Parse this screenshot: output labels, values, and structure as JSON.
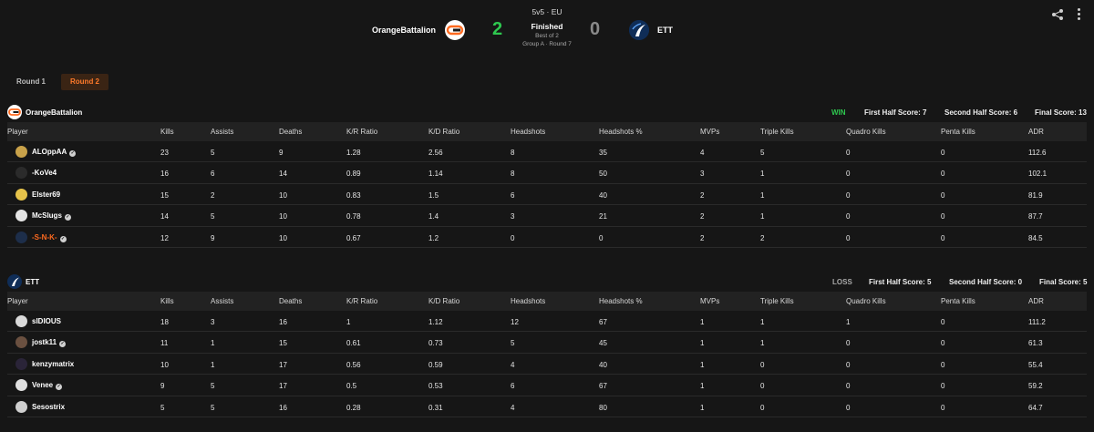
{
  "header": {
    "team1": {
      "name": "OrangeBattalion",
      "score": "2"
    },
    "team2": {
      "name": "ETT",
      "score": "0"
    },
    "mode": "5v5 · EU",
    "status": "Finished",
    "best_of": "Best of 2",
    "group": "Group A · Round 7",
    "colors": {
      "win": "#2ec84f",
      "lose": "#8a8a8a",
      "accent": "#ff7a2a"
    }
  },
  "icons": {
    "share": "share-icon",
    "more": "more-vertical-icon",
    "verified": "verified-check-icon"
  },
  "tabs": [
    {
      "label": "Round 1",
      "active": false
    },
    {
      "label": "Round 2",
      "active": true
    }
  ],
  "columns": [
    "Player",
    "Kills",
    "Assists",
    "Deaths",
    "K/R Ratio",
    "K/D Ratio",
    "Headshots",
    "Headshots %",
    "MVPs",
    "Triple Kills",
    "Quadro Kills",
    "Penta Kills",
    "ADR"
  ],
  "teams": [
    {
      "name": "OrangeBattalion",
      "result": "WIN",
      "first_half": "First Half Score: 7",
      "second_half": "Second Half Score: 6",
      "final": "Final Score: 13",
      "players": [
        {
          "name": "ALOppAA",
          "verified": true,
          "stats": [
            "23",
            "5",
            "9",
            "1.28",
            "2.56",
            "8",
            "35",
            "4",
            "5",
            "0",
            "0",
            "112.6"
          ]
        },
        {
          "name": "-KoVe4",
          "verified": false,
          "stats": [
            "16",
            "6",
            "14",
            "0.89",
            "1.14",
            "8",
            "50",
            "3",
            "1",
            "0",
            "0",
            "102.1"
          ]
        },
        {
          "name": "Elster69",
          "verified": false,
          "stats": [
            "15",
            "2",
            "10",
            "0.83",
            "1.5",
            "6",
            "40",
            "2",
            "1",
            "0",
            "0",
            "81.9"
          ]
        },
        {
          "name": "McSlugs",
          "verified": true,
          "stats": [
            "14",
            "5",
            "10",
            "0.78",
            "1.4",
            "3",
            "21",
            "2",
            "1",
            "0",
            "0",
            "87.7"
          ]
        },
        {
          "name": "-S-N-K-",
          "verified": true,
          "highlight": true,
          "stats": [
            "12",
            "9",
            "10",
            "0.67",
            "1.2",
            "0",
            "0",
            "2",
            "2",
            "0",
            "0",
            "84.5"
          ]
        }
      ]
    },
    {
      "name": "ETT",
      "result": "LOSS",
      "first_half": "First Half Score: 5",
      "second_half": "Second Half Score: 0",
      "final": "Final Score: 5",
      "players": [
        {
          "name": "sIDIOUS",
          "verified": false,
          "stats": [
            "18",
            "3",
            "16",
            "1",
            "1.12",
            "12",
            "67",
            "1",
            "1",
            "1",
            "0",
            "111.2"
          ]
        },
        {
          "name": "jostk11",
          "verified": true,
          "stats": [
            "11",
            "1",
            "15",
            "0.61",
            "0.73",
            "5",
            "45",
            "1",
            "1",
            "0",
            "0",
            "61.3"
          ]
        },
        {
          "name": "kenzymatrix",
          "verified": false,
          "stats": [
            "10",
            "1",
            "17",
            "0.56",
            "0.59",
            "4",
            "40",
            "1",
            "0",
            "0",
            "0",
            "55.4"
          ]
        },
        {
          "name": "Venee",
          "verified": true,
          "stats": [
            "9",
            "5",
            "17",
            "0.5",
            "0.53",
            "6",
            "67",
            "1",
            "0",
            "0",
            "0",
            "59.2"
          ]
        },
        {
          "name": "Sesostrix",
          "verified": false,
          "stats": [
            "5",
            "5",
            "16",
            "0.28",
            "0.31",
            "4",
            "80",
            "1",
            "0",
            "0",
            "0",
            "64.7"
          ]
        }
      ]
    }
  ]
}
